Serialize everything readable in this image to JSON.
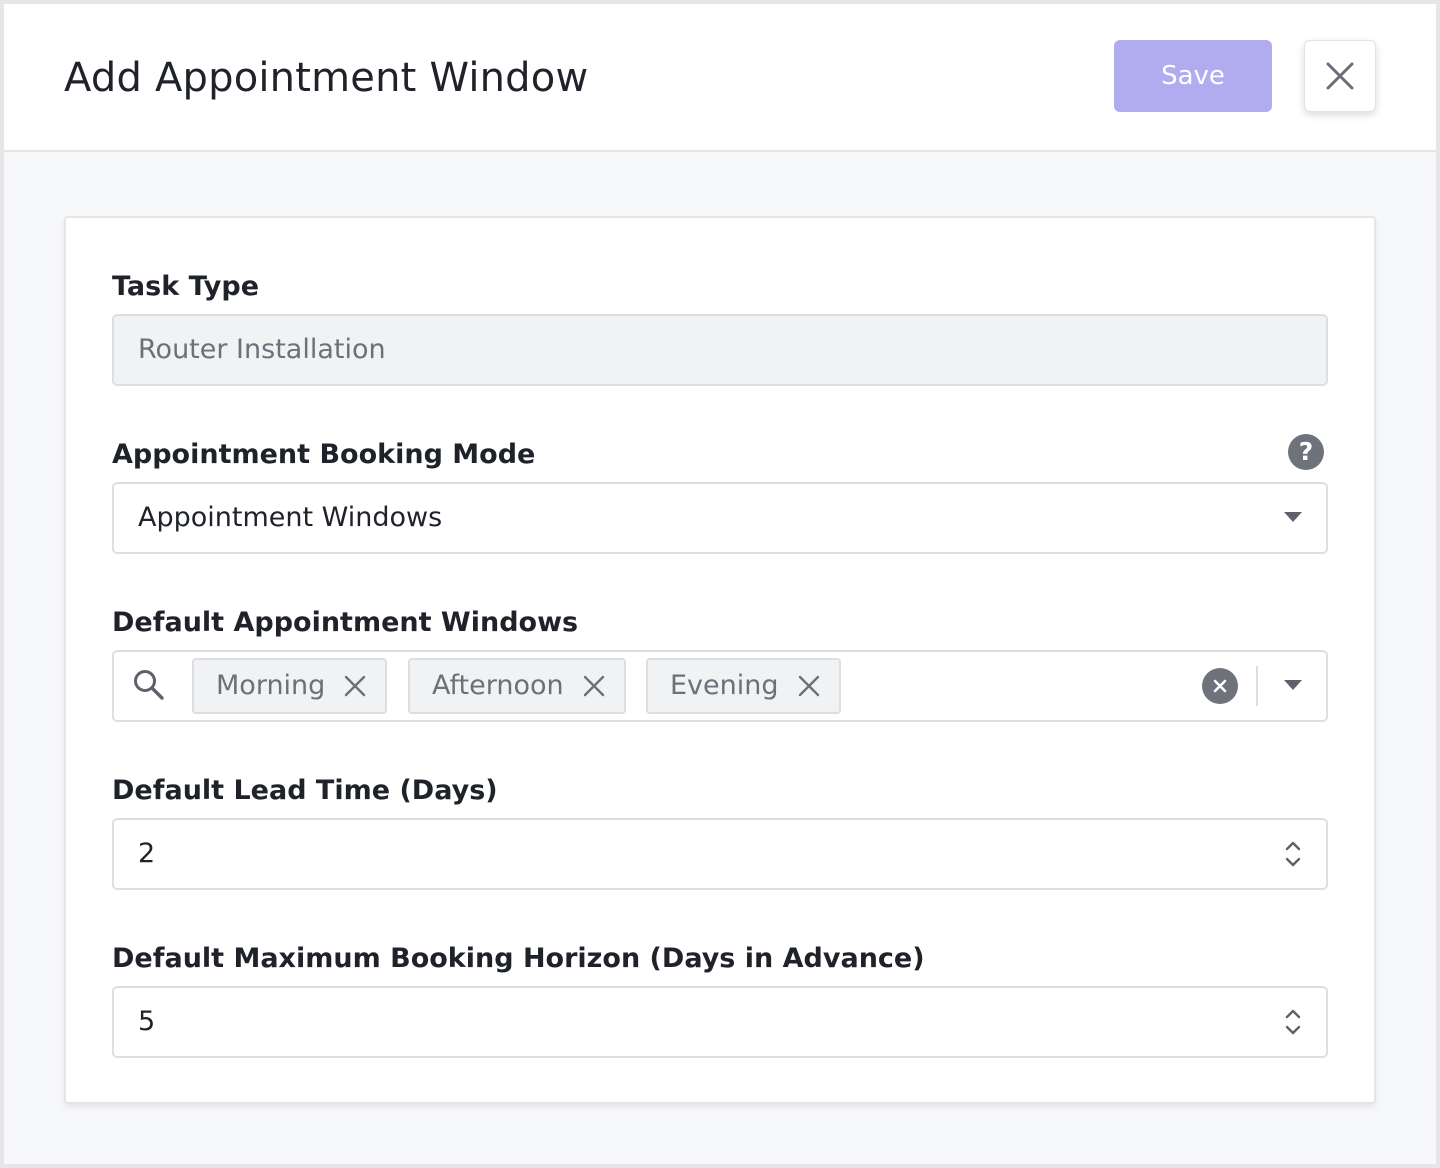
{
  "header": {
    "title": "Add Appointment Window",
    "save_label": "Save"
  },
  "form": {
    "task_type": {
      "label": "Task Type",
      "value": "Router Installation"
    },
    "booking_mode": {
      "label": "Appointment Booking Mode",
      "help_glyph": "?",
      "value": "Appointment Windows"
    },
    "default_windows": {
      "label": "Default Appointment Windows",
      "chips": [
        "Morning",
        "Afternoon",
        "Evening"
      ]
    },
    "lead_time": {
      "label": "Default Lead Time (Days)",
      "value": "2"
    },
    "booking_horizon": {
      "label": "Default Maximum Booking Horizon (Days in Advance)",
      "value": "5"
    }
  },
  "colors": {
    "accent_disabled": "#b1abf0",
    "icon_gray": "#6e727a"
  },
  "icons": [
    "close-icon",
    "help-icon",
    "search-icon",
    "chip-remove-icon",
    "clear-all-icon",
    "chevron-down-icon",
    "stepper-icon"
  ]
}
